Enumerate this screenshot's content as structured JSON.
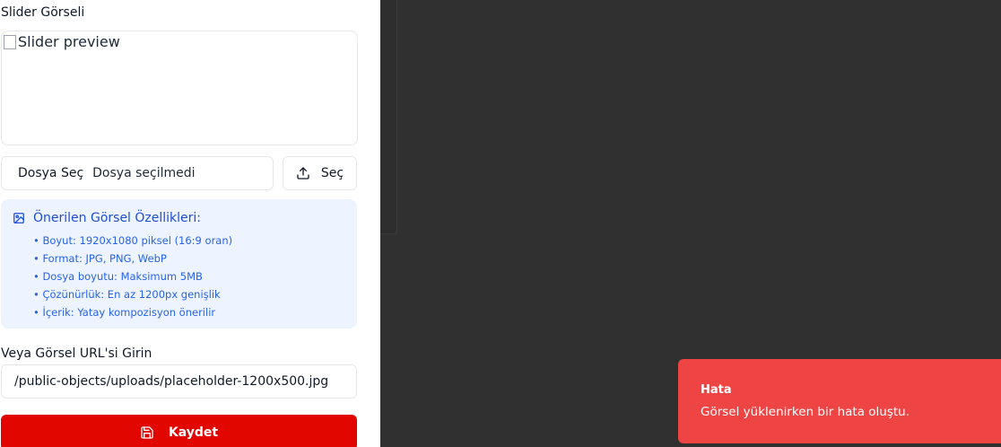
{
  "form": {
    "image_label": "Slider Görseli",
    "preview_alt": "Slider preview",
    "file_button_label": "Dosya Seç",
    "file_status": "Dosya seçilmedi",
    "choose_label": "Seç",
    "info": {
      "title": "Önerilen Görsel Özellikleri:",
      "items": [
        "• Boyut: 1920x1080 piksel (16:9 oran)",
        "• Format: JPG, PNG, WebP",
        "• Dosya boyutu: Maksimum 5MB",
        "• Çözünürlük: En az 1200px genişlik",
        "• İçerik: Yatay kompozisyon önerilir"
      ]
    },
    "url_label": "Veya Görsel URL'si Girin",
    "url_value": "/public-objects/uploads/placeholder-1200x500.jpg",
    "save_label": "Kaydet"
  },
  "toast": {
    "title": "Hata",
    "message": "Görsel yüklenirken bir hata oluştu."
  },
  "colors": {
    "primary": "#e10600",
    "toast_error": "#ef4444",
    "info_bg": "#eef4ff",
    "info_text": "#2563eb",
    "backdrop": "#303030"
  },
  "icons": {
    "upload": "upload-icon",
    "image": "image-icon",
    "save": "save-icon",
    "broken_image": "broken-image-icon"
  }
}
